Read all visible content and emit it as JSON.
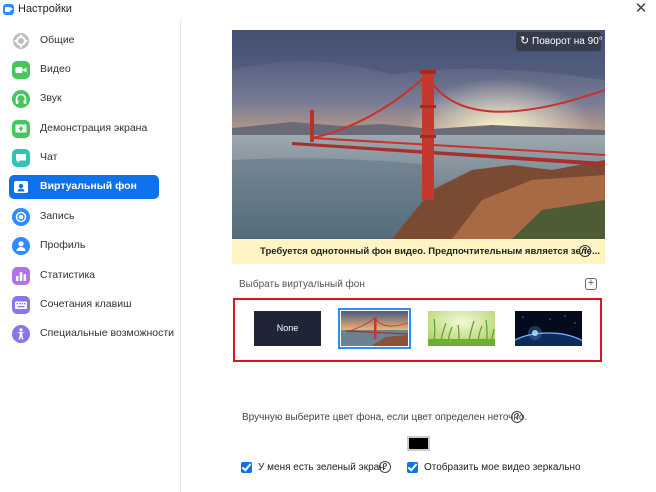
{
  "window": {
    "title": "Настройки",
    "close_glyph": "✕"
  },
  "sidebar": {
    "items": [
      {
        "label": "Общие",
        "icon": "gear-icon",
        "color": "#bdbdbd",
        "active": false
      },
      {
        "label": "Видео",
        "icon": "video-camera-icon",
        "color": "#45c75e",
        "active": false
      },
      {
        "label": "Звук",
        "icon": "headphones-icon",
        "color": "#45c75e",
        "active": false
      },
      {
        "label": "Демонстрация экрана",
        "icon": "screen-share-icon",
        "color": "#45c75e",
        "active": false
      },
      {
        "label": "Чат",
        "icon": "chat-bubble-icon",
        "color": "#30c4b5",
        "active": false
      },
      {
        "label": "Виртуальный фон",
        "icon": "person-card-icon",
        "color": "#ffffff",
        "active": true
      },
      {
        "label": "Запись",
        "icon": "record-icon",
        "color": "#2d8cff",
        "active": false
      },
      {
        "label": "Профиль",
        "icon": "person-icon",
        "color": "#2d8cff",
        "active": false
      },
      {
        "label": "Статистика",
        "icon": "bar-chart-icon",
        "color": "#b174e8",
        "active": false
      },
      {
        "label": "Сочетания клавиш",
        "icon": "keyboard-icon",
        "color": "#8a76e8",
        "active": false
      },
      {
        "label": "Специальные возможности",
        "icon": "accessibility-icon",
        "color": "#8a76e8",
        "active": false
      }
    ]
  },
  "preview": {
    "rotate_label": "Поворот на 90°",
    "rotate_icon": "rotate-icon"
  },
  "warning": {
    "text": "Требуется однотонный фон видео. Предпочтительным является зеле...",
    "help_glyph": "?"
  },
  "choose": {
    "label": "Выбрать виртуальный фон",
    "add_glyph": "+"
  },
  "thumbnails": [
    {
      "label": "None",
      "type": "none",
      "selected": false
    },
    {
      "type": "bridge",
      "selected": true
    },
    {
      "type": "grass",
      "selected": false
    },
    {
      "type": "space",
      "selected": false
    }
  ],
  "manual_color": {
    "label": "Вручную выберите цвет фона, если цвет определен неточно.",
    "help_glyph": "?",
    "swatch_color": "#000000"
  },
  "options": {
    "green_screen_label": "У меня есть зеленый экран",
    "green_screen_checked": true,
    "green_help_glyph": "?",
    "mirror_label": "Отобразить мое видео зеркально",
    "mirror_checked": true
  },
  "colors": {
    "accent": "#0e72ed",
    "highlight_frame": "#e0141e",
    "warning_bg": "#fff4c4"
  }
}
